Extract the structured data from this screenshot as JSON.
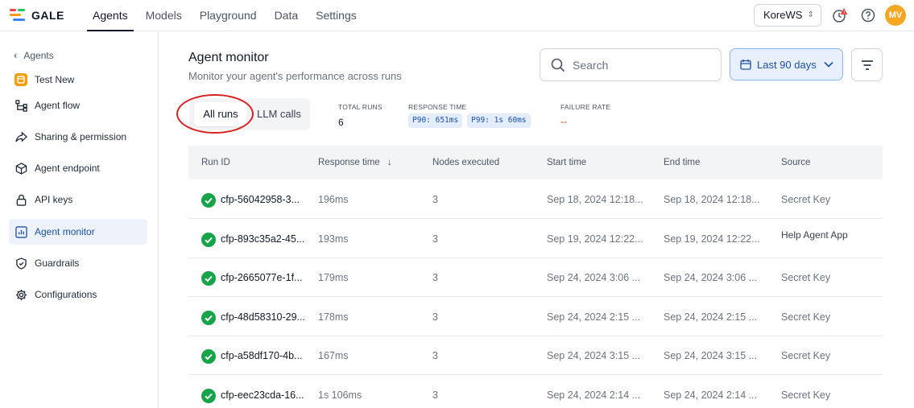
{
  "app": {
    "logo_text": "GALE"
  },
  "nav": {
    "items": [
      "Agents",
      "Models",
      "Playground",
      "Data",
      "Settings"
    ],
    "active": "Agents"
  },
  "workspace": {
    "selected": "KoreWS"
  },
  "user": {
    "initials": "MV",
    "avatar_color": "#f5a623"
  },
  "sidebar": {
    "back_label": "Agents",
    "items": [
      {
        "label": "Test New",
        "icon": "agent-app-icon"
      },
      {
        "label": "Agent flow",
        "icon": "flow-icon"
      },
      {
        "label": "Sharing & permission",
        "icon": "share-icon"
      },
      {
        "label": "Agent endpoint",
        "icon": "cube-icon"
      },
      {
        "label": "API keys",
        "icon": "lock-icon"
      },
      {
        "label": "Agent monitor",
        "icon": "chart-icon",
        "active": true
      },
      {
        "label": "Guardrails",
        "icon": "shield-icon"
      },
      {
        "label": "Configurations",
        "icon": "gear-icon"
      }
    ]
  },
  "header": {
    "title": "Agent monitor",
    "subtitle": "Monitor your agent's performance across runs",
    "search_placeholder": "Search",
    "date_range": "Last 90 days"
  },
  "tabs": {
    "all_runs": "All runs",
    "llm_calls": "LLM calls",
    "active": "All runs"
  },
  "stats": {
    "total_runs_label": "TOTAL RUNS",
    "total_runs_value": "6",
    "response_time_label": "RESPONSE TIME",
    "p90": "P90: 651ms",
    "p99": "P99: 1s 60ms",
    "failure_rate_label": "FAILURE RATE",
    "failure_rate_value": "--"
  },
  "table": {
    "columns": [
      "Run ID",
      "Response time",
      "Nodes executed",
      "Start time",
      "End time",
      "Source"
    ],
    "rows": [
      {
        "id": "cfp-56042958-3...",
        "response": "196ms",
        "nodes": "3",
        "start": "Sep 18, 2024 12:18...",
        "end": "Sep 18, 2024 12:18...",
        "source": "Secret Key"
      },
      {
        "id": "cfp-893c35a2-45...",
        "response": "193ms",
        "nodes": "3",
        "start": "Sep 19, 2024 12:22...",
        "end": "Sep 19, 2024 12:22...",
        "source": "Help Agent App"
      },
      {
        "id": "cfp-2665077e-1f...",
        "response": "179ms",
        "nodes": "3",
        "start": "Sep 24, 2024 3:06 ...",
        "end": "Sep 24, 2024 3:06 ...",
        "source": "Secret Key"
      },
      {
        "id": "cfp-48d58310-29...",
        "response": "178ms",
        "nodes": "3",
        "start": "Sep 24, 2024 2:15 ...",
        "end": "Sep 24, 2024 2:15 ...",
        "source": "Secret Key"
      },
      {
        "id": "cfp-a58df170-4b...",
        "response": "167ms",
        "nodes": "3",
        "start": "Sep 24, 2024 3:15 ...",
        "end": "Sep 24, 2024 3:15 ...",
        "source": "Secret Key"
      },
      {
        "id": "cfp-eec23cda-16...",
        "response": "1s 106ms",
        "nodes": "3",
        "start": "Sep 24, 2024 2:14 ...",
        "end": "Sep 24, 2024 2:14 ...",
        "source": "Secret Key"
      }
    ]
  },
  "colors": {
    "accent": "#1e4fa8",
    "success": "#16a34a",
    "annotation": "#d92020",
    "notification": "#ef4444"
  }
}
